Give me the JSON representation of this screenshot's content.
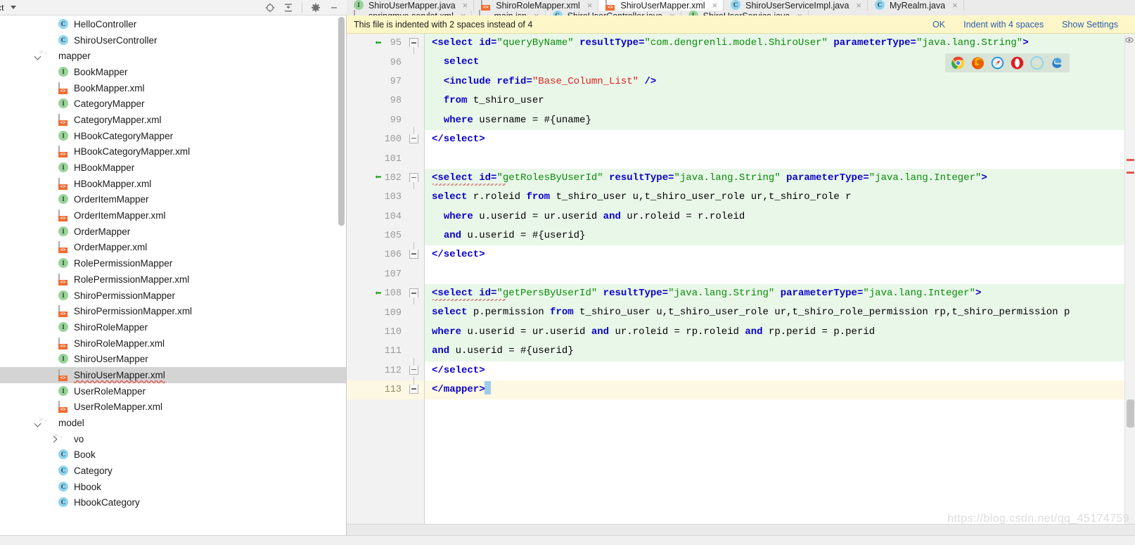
{
  "project_panel": {
    "title": "ct",
    "tools": [
      {
        "name": "locate-icon",
        "label": "Select Opened File"
      },
      {
        "name": "collapse-all-icon",
        "label": "Collapse All"
      },
      {
        "name": "gear-icon",
        "label": "Settings"
      },
      {
        "name": "minimize-icon",
        "label": "Hide"
      }
    ],
    "tree": [
      {
        "indent": 3,
        "icon": "class",
        "label": "HelloController"
      },
      {
        "indent": 3,
        "icon": "class",
        "label": "ShiroUserController"
      },
      {
        "indent": 2,
        "icon": "folder",
        "arrow": "down",
        "label": "mapper"
      },
      {
        "indent": 3,
        "icon": "interface",
        "label": "BookMapper"
      },
      {
        "indent": 3,
        "icon": "xml",
        "label": "BookMapper.xml"
      },
      {
        "indent": 3,
        "icon": "interface",
        "label": "CategoryMapper"
      },
      {
        "indent": 3,
        "icon": "xml",
        "label": "CategoryMapper.xml"
      },
      {
        "indent": 3,
        "icon": "interface",
        "label": "HBookCategoryMapper"
      },
      {
        "indent": 3,
        "icon": "xml",
        "label": "HBookCategoryMapper.xml"
      },
      {
        "indent": 3,
        "icon": "interface",
        "label": "HBookMapper"
      },
      {
        "indent": 3,
        "icon": "xml",
        "label": "HBookMapper.xml"
      },
      {
        "indent": 3,
        "icon": "interface",
        "label": "OrderItemMapper"
      },
      {
        "indent": 3,
        "icon": "xml",
        "label": "OrderItemMapper.xml"
      },
      {
        "indent": 3,
        "icon": "interface",
        "label": "OrderMapper"
      },
      {
        "indent": 3,
        "icon": "xml",
        "label": "OrderMapper.xml"
      },
      {
        "indent": 3,
        "icon": "interface",
        "label": "RolePermissionMapper"
      },
      {
        "indent": 3,
        "icon": "xml",
        "label": "RolePermissionMapper.xml"
      },
      {
        "indent": 3,
        "icon": "interface",
        "label": "ShiroPermissionMapper"
      },
      {
        "indent": 3,
        "icon": "xml",
        "label": "ShiroPermissionMapper.xml"
      },
      {
        "indent": 3,
        "icon": "interface",
        "label": "ShiroRoleMapper"
      },
      {
        "indent": 3,
        "icon": "xml",
        "label": "ShiroRoleMapper.xml"
      },
      {
        "indent": 3,
        "icon": "interface",
        "label": "ShiroUserMapper"
      },
      {
        "indent": 3,
        "icon": "xml",
        "label": "ShiroUserMapper.xml",
        "selected": true,
        "error": true
      },
      {
        "indent": 3,
        "icon": "interface",
        "label": "UserRoleMapper"
      },
      {
        "indent": 3,
        "icon": "xml",
        "label": "UserRoleMapper.xml"
      },
      {
        "indent": 2,
        "icon": "folder",
        "arrow": "down",
        "label": "model"
      },
      {
        "indent": 3,
        "icon": "folder",
        "arrow": "right",
        "label": "vo"
      },
      {
        "indent": 3,
        "icon": "class",
        "label": "Book"
      },
      {
        "indent": 3,
        "icon": "class",
        "label": "Category"
      },
      {
        "indent": 3,
        "icon": "class",
        "label": "Hbook"
      },
      {
        "indent": 3,
        "icon": "class",
        "label": "HbookCategory"
      }
    ]
  },
  "editor_tabs": {
    "row1": [
      {
        "icon": "interface",
        "label": "ShiroUserMapper.java",
        "active": false,
        "closable": true
      },
      {
        "icon": "xml",
        "label": "ShiroRoleMapper.xml",
        "active": false,
        "closable": true
      },
      {
        "icon": "xml",
        "label": "ShiroUserMapper.xml",
        "active": true,
        "closable": true
      },
      {
        "icon": "class",
        "label": "ShiroUserServiceImpl.java",
        "active": false,
        "closable": true
      },
      {
        "icon": "class",
        "label": "MyRealm.java",
        "active": false,
        "closable": true
      }
    ],
    "row2": [
      {
        "icon": "xml-green",
        "label": "springmvc-servlet.xml",
        "active": false,
        "closable": true
      },
      {
        "icon": "jsp",
        "label": "main.jsp",
        "active": false,
        "closable": true
      },
      {
        "icon": "class",
        "label": "ShiroUserController.java",
        "active": false,
        "closable": true
      },
      {
        "icon": "interface",
        "label": "ShiroUserService.java",
        "active": false,
        "closable": true
      }
    ]
  },
  "notification": {
    "message": "This file is indented with 2 spaces instead of 4",
    "actions": [
      {
        "name": "ok-link",
        "label": "OK"
      },
      {
        "name": "indent-with-4-spaces-link",
        "label": "Indent with 4 spaces"
      },
      {
        "name": "show-settings-link",
        "label": "Show Settings"
      }
    ]
  },
  "browser_run_icons": [
    {
      "name": "chrome-icon",
      "color": "#4caf50"
    },
    {
      "name": "firefox-icon",
      "color": "#e66000"
    },
    {
      "name": "safari-icon",
      "color": "#1d8fe1"
    },
    {
      "name": "opera-icon",
      "color": "#e01b24"
    },
    {
      "name": "internet-explorer-icon",
      "color": "#66c6e8"
    },
    {
      "name": "edge-icon",
      "color": "#2a7fc9"
    }
  ],
  "code": {
    "first_line_number": 95,
    "current_line": 113,
    "lines": [
      {
        "n": 95,
        "bg": "hl",
        "marker": true,
        "fold": "start",
        "text": "<select id=\"queryByName\" resultType=\"com.dengrenli.model.ShiroUser\" parameterType=\"java.lang.String\">"
      },
      {
        "n": 96,
        "bg": "hl",
        "text": "  select"
      },
      {
        "n": 97,
        "bg": "hl",
        "text": "  <include refid=\"Base_Column_List\" />"
      },
      {
        "n": 98,
        "bg": "hl",
        "text": "  from t_shiro_user"
      },
      {
        "n": 99,
        "bg": "hl",
        "text": "  where username = #{uname}"
      },
      {
        "n": 100,
        "bg": "none",
        "fold": "end",
        "text": "</select>"
      },
      {
        "n": 101,
        "bg": "none",
        "text": ""
      },
      {
        "n": 102,
        "bg": "hl",
        "marker": true,
        "fold": "start",
        "text": "<select id=\"getRolesByUserId\" resultType=\"java.lang.String\" parameterType=\"java.lang.Integer\">"
      },
      {
        "n": 103,
        "bg": "hl",
        "text": "select r.roleid from t_shiro_user u,t_shiro_user_role ur,t_shiro_role r"
      },
      {
        "n": 104,
        "bg": "hl",
        "text": "  where u.userid = ur.userid and ur.roleid = r.roleid"
      },
      {
        "n": 105,
        "bg": "hl",
        "text": "  and u.userid = #{userid}"
      },
      {
        "n": 106,
        "bg": "none",
        "fold": "end",
        "text": "</select>"
      },
      {
        "n": 107,
        "bg": "none",
        "text": ""
      },
      {
        "n": 108,
        "bg": "hl",
        "marker": true,
        "fold": "start",
        "text": "<select id=\"getPersByUserId\" resultType=\"java.lang.String\" parameterType=\"java.lang.Integer\">"
      },
      {
        "n": 109,
        "bg": "hl",
        "text": "select p.permission from t_shiro_user u,t_shiro_user_role ur,t_shiro_role_permission rp,t_shiro_permission p"
      },
      {
        "n": 110,
        "bg": "hl",
        "text": "where u.userid = ur.userid and ur.roleid = rp.roleid and rp.perid = p.perid"
      },
      {
        "n": 111,
        "bg": "hl",
        "text": "and u.userid = #{userid}"
      },
      {
        "n": 112,
        "bg": "none",
        "fold": "end",
        "text": "</select>"
      },
      {
        "n": 113,
        "bg": "cur",
        "fold": "end",
        "text": "</mapper>"
      }
    ]
  },
  "watermark": "https://blog.csdn.net/qq_45174759",
  "colors": {
    "tag": "#0a00c8",
    "attr_value": "#068c06",
    "string_ref": "#e02020",
    "highlight_block": "#e9f7e9",
    "current_line": "#fdf8e3",
    "notification_bg": "#fdf6c8",
    "link": "#2a5db0",
    "selection": "#d4d4d4",
    "error": "#e05a4f"
  }
}
